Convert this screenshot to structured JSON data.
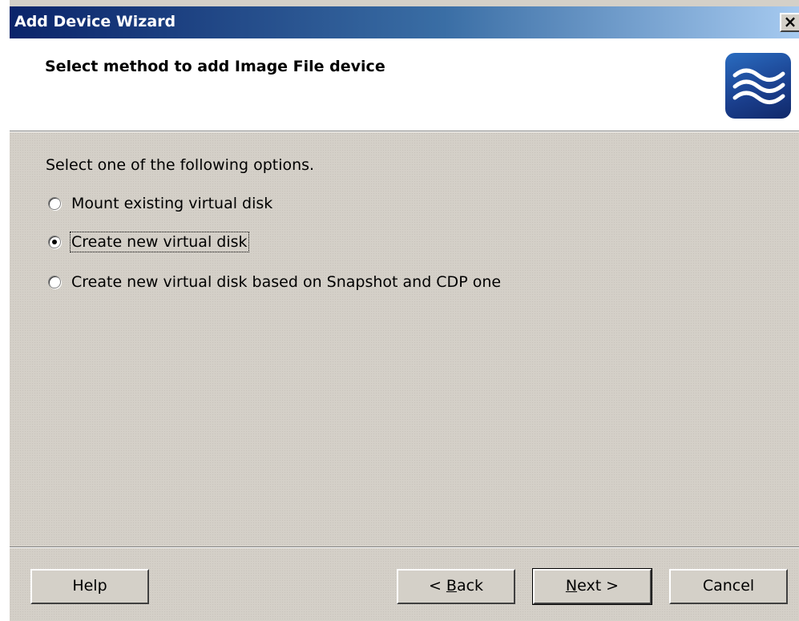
{
  "window": {
    "title": "Add Device Wizard",
    "close_label": "×"
  },
  "header": {
    "title": "Select method to add Image File device",
    "logo_icon": "waves-logo-icon"
  },
  "body": {
    "instruction": "Select one of the following options.",
    "options": [
      {
        "label": "Mount existing virtual disk",
        "checked": false
      },
      {
        "label": "Create new virtual disk",
        "checked": true
      },
      {
        "label": "Create new virtual disk based on Snapshot and CDP one",
        "checked": false
      }
    ]
  },
  "footer": {
    "help_label": "Help",
    "back_prefix": "< ",
    "back_accel": "B",
    "back_rest": "ack",
    "next_accel": "N",
    "next_rest": "ext >",
    "cancel_label": "Cancel"
  },
  "colors": {
    "title_gradient_start": "#0a246a",
    "title_gradient_end": "#a6caf0",
    "dialog_bg": "#d4d0c8",
    "logo_blue": "#1a3e8c"
  }
}
